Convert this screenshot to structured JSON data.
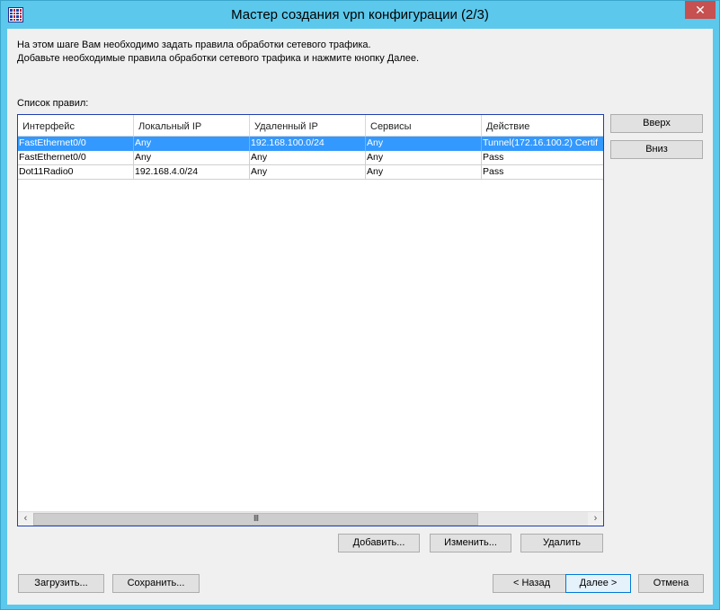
{
  "window": {
    "title": "Мастер создания vpn конфигурации (2/3)",
    "close_glyph": "✕"
  },
  "intro": {
    "line1": "На этом шаге Вам необходимо задать правила обработки сетевого трафика.",
    "line2": "Добавьте необходимые правила обработки сетевого трафика и нажмите кнопку Далее."
  },
  "rules": {
    "label": "Список правил:",
    "columns": [
      "Интерфейс",
      "Локальный IP",
      "Удаленный IP",
      "Сервисы",
      "Действие"
    ],
    "rows": [
      {
        "interface": "FastEthernet0/0",
        "local_ip": "Any",
        "remote_ip": "192.168.100.0/24",
        "services": "Any",
        "action": "Tunnel(172.16.100.2) Certif",
        "selected": true
      },
      {
        "interface": "FastEthernet0/0",
        "local_ip": "Any",
        "remote_ip": "Any",
        "services": "Any",
        "action": "Pass",
        "selected": false
      },
      {
        "interface": "Dot11Radio0",
        "local_ip": "192.168.4.0/24",
        "remote_ip": "Any",
        "services": "Any",
        "action": "Pass",
        "selected": false
      }
    ],
    "scroll_thumb_grip": "III"
  },
  "buttons": {
    "up": "Вверх",
    "down": "Вниз",
    "add": "Добавить...",
    "edit": "Изменить...",
    "delete": "Удалить",
    "load": "Загрузить...",
    "save": "Сохранить...",
    "back": "< Назад",
    "next": "Далее >",
    "cancel": "Отмена"
  },
  "colors": {
    "title_bar": "#5bc8ec",
    "selection": "#3399ff",
    "close_button": "#c75050"
  }
}
